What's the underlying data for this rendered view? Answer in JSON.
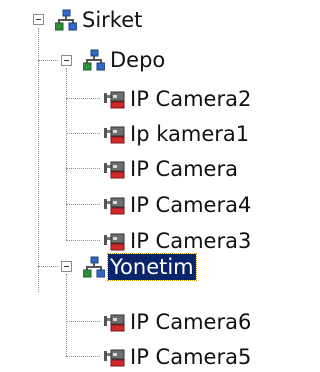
{
  "tree": {
    "root": {
      "label": "Sirket",
      "icon": "network-group-icon",
      "expanded": true
    },
    "groups": [
      {
        "label": "Depo",
        "icon": "network-group-icon",
        "expanded": true,
        "selected": false,
        "cameras": [
          {
            "label": "IP Camera2",
            "icon": "ip-camera-icon"
          },
          {
            "label": "Ip kamera1",
            "icon": "ip-camera-icon"
          },
          {
            "label": "IP Camera",
            "icon": "ip-camera-icon"
          },
          {
            "label": "IP Camera4",
            "icon": "ip-camera-icon"
          },
          {
            "label": "IP Camera3",
            "icon": "ip-camera-icon"
          }
        ]
      },
      {
        "label": "Yonetim",
        "icon": "network-group-icon",
        "expanded": true,
        "selected": true,
        "cameras": [
          {
            "label": "IP Camera6",
            "icon": "ip-camera-icon"
          },
          {
            "label": "IP Camera5",
            "icon": "ip-camera-icon"
          }
        ]
      }
    ],
    "colors": {
      "selection_background": "#0a246a",
      "selection_text": "#ffffff",
      "connector_line": "#8f8f8f",
      "network_icon_blue": "#2f68c6",
      "network_icon_green": "#2f8f3a",
      "camera_red": "#cf2a2a"
    }
  }
}
